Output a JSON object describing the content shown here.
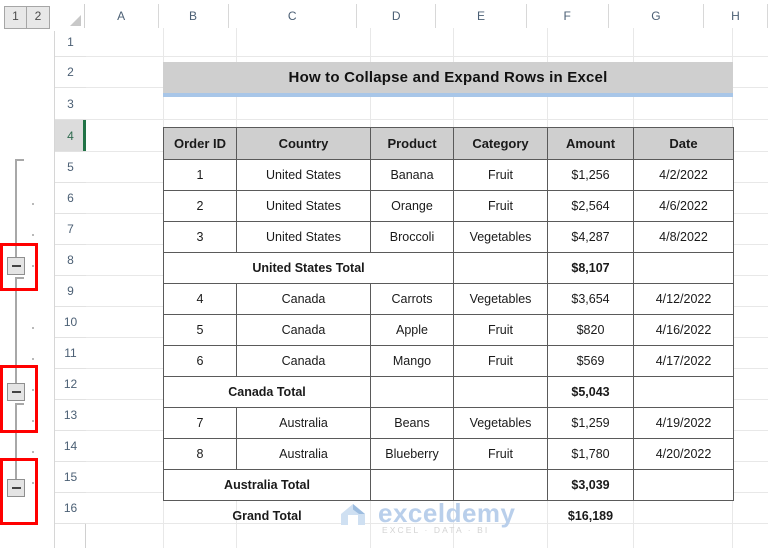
{
  "outline": {
    "level_buttons": [
      "1",
      "2"
    ],
    "collapse_icon": "minus-icon",
    "groups": [
      {
        "label": "united-states-group",
        "collapse_row": 8
      },
      {
        "label": "canada-group",
        "collapse_row": 12
      },
      {
        "label": "australia-group",
        "collapse_row": 15
      }
    ]
  },
  "sheet": {
    "column_headers": [
      "A",
      "B",
      "C",
      "D",
      "E",
      "F",
      "G",
      "H"
    ],
    "row_headers": [
      "1",
      "2",
      "3",
      "4",
      "5",
      "6",
      "7",
      "8",
      "9",
      "10",
      "11",
      "12",
      "13",
      "14",
      "15",
      "16"
    ],
    "selected_row": "4",
    "select_all_icon": "select-all-triangle-icon"
  },
  "title": {
    "text": "How to Collapse and Expand Rows in Excel",
    "banner_color": "#cfcfcf",
    "underline_color": "#a8c6e8"
  },
  "table": {
    "headers": [
      "Order ID",
      "Country",
      "Product",
      "Category",
      "Amount",
      "Date"
    ],
    "rows": [
      {
        "type": "data",
        "cells": [
          "1",
          "United States",
          "Banana",
          "Fruit",
          "$1,256",
          "4/2/2022"
        ]
      },
      {
        "type": "data",
        "cells": [
          "2",
          "United States",
          "Orange",
          "Fruit",
          "$2,564",
          "4/6/2022"
        ]
      },
      {
        "type": "data",
        "cells": [
          "3",
          "United States",
          "Broccoli",
          "Vegetables",
          "$4,287",
          "4/8/2022"
        ]
      },
      {
        "type": "subtotal",
        "label": "United States Total",
        "amount": "$8,107"
      },
      {
        "type": "data",
        "cells": [
          "4",
          "Canada",
          "Carrots",
          "Vegetables",
          "$3,654",
          "4/12/2022"
        ]
      },
      {
        "type": "data",
        "cells": [
          "5",
          "Canada",
          "Apple",
          "Fruit",
          "$820",
          "4/16/2022"
        ]
      },
      {
        "type": "data",
        "cells": [
          "6",
          "Canada",
          "Mango",
          "Fruit",
          "$569",
          "4/17/2022"
        ]
      },
      {
        "type": "subtotal",
        "label": "Canada  Total",
        "amount": "$5,043"
      },
      {
        "type": "data",
        "cells": [
          "7",
          "Australia",
          "Beans",
          "Vegetables",
          "$1,259",
          "4/19/2022"
        ]
      },
      {
        "type": "data",
        "cells": [
          "8",
          "Australia",
          "Blueberry",
          "Fruit",
          "$1,780",
          "4/20/2022"
        ]
      },
      {
        "type": "subtotal",
        "label": "Australia  Total",
        "amount": "$3,039"
      }
    ],
    "grand_total": {
      "label": "Grand Total",
      "amount": "$16,189"
    }
  },
  "watermark": {
    "name": "exceldemy",
    "tagline": "EXCEL · DATA · BI"
  }
}
